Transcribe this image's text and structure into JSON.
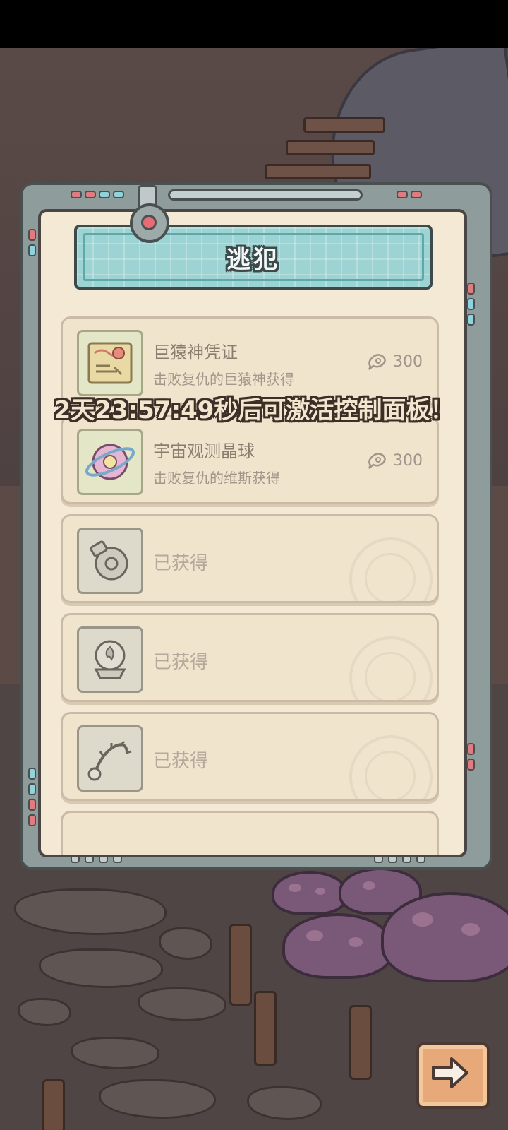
{
  "panel": {
    "title": "逃犯",
    "countdown": "2天23:57:49秒后可激活控制面板！"
  },
  "items": [
    {
      "name": "巨猿神凭证",
      "desc": "击败复仇的巨猿神获得",
      "cost": "300",
      "icon": "map-scroll-icon",
      "status": "locked"
    },
    {
      "name": "宇宙观测晶球",
      "desc": "击败复仇的维斯获得",
      "cost": "300",
      "icon": "cosmic-orb-icon",
      "status": "locked"
    },
    {
      "name": "已获得",
      "icon": "gear-engine-icon",
      "status": "obtained"
    },
    {
      "name": "已获得",
      "icon": "flame-crystal-ball-icon",
      "status": "obtained"
    },
    {
      "name": "已获得",
      "icon": "spiked-chain-icon",
      "status": "obtained"
    }
  ],
  "colors": {
    "banner": "#9dd3d2",
    "paper": "#f4e9d4",
    "frame": "#8e9c9c",
    "next_button": "#e8a97a"
  }
}
